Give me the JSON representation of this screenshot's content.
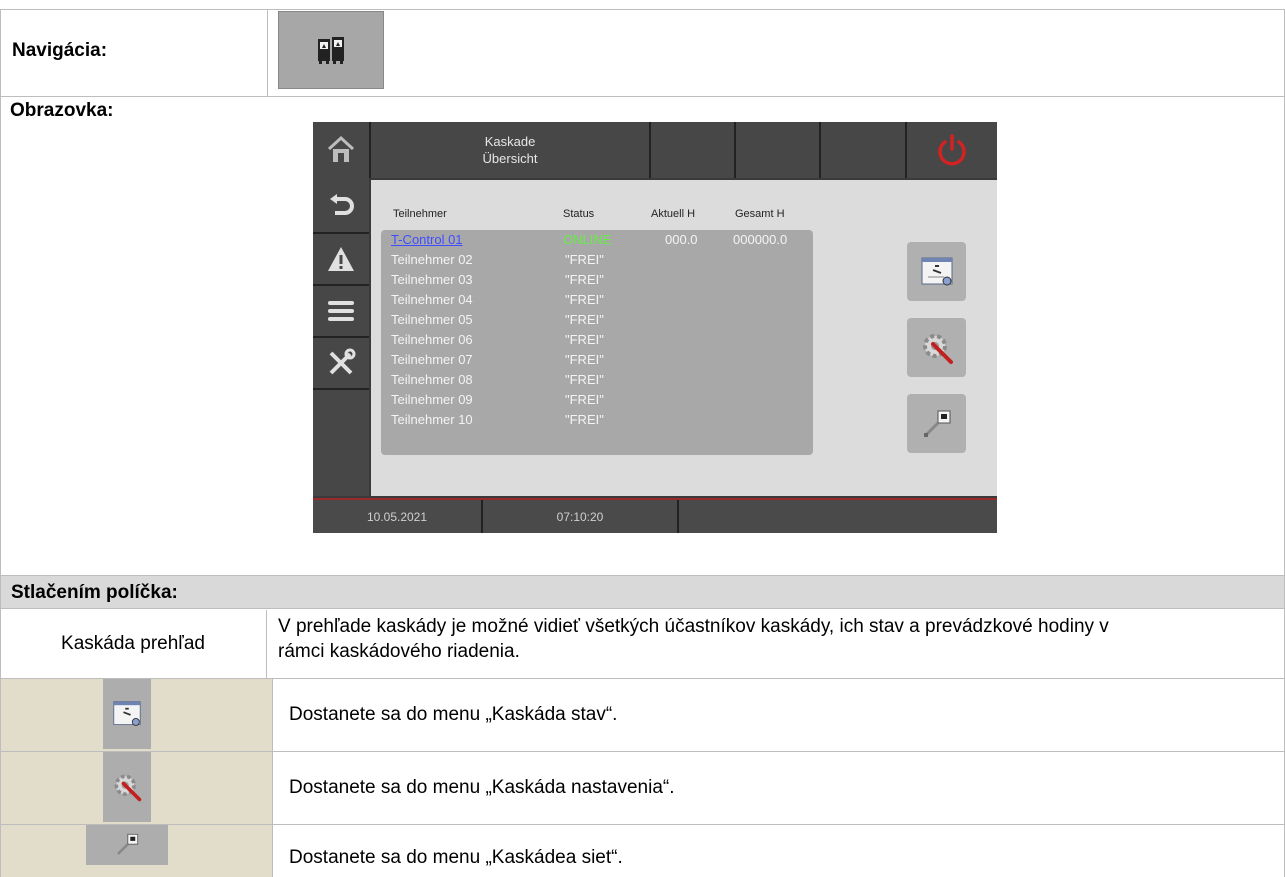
{
  "navigation": {
    "label": "Navigácia:",
    "icon": "cascade-boilers-icon"
  },
  "screen": {
    "label": "Obrazovka:",
    "device": {
      "title_line1": "Kaskade",
      "title_line2": "Übersicht",
      "columns": {
        "participant": "Teilnehmer",
        "status": "Status",
        "current": "Aktuell H",
        "total": "Gesamt H"
      },
      "rows": [
        {
          "name": "T-Control 01",
          "status": "ONLINE",
          "current": "000.0",
          "total": "000000.0"
        },
        {
          "name": "Teilnehmer 02",
          "status": "\"FREI\"",
          "current": "",
          "total": ""
        },
        {
          "name": "Teilnehmer 03",
          "status": "\"FREI\"",
          "current": "",
          "total": ""
        },
        {
          "name": "Teilnehmer 04",
          "status": "\"FREI\"",
          "current": "",
          "total": ""
        },
        {
          "name": "Teilnehmer 05",
          "status": "\"FREI\"",
          "current": "",
          "total": ""
        },
        {
          "name": "Teilnehmer 06",
          "status": "\"FREI\"",
          "current": "",
          "total": ""
        },
        {
          "name": "Teilnehmer 07",
          "status": "\"FREI\"",
          "current": "",
          "total": ""
        },
        {
          "name": "Teilnehmer 08",
          "status": "\"FREI\"",
          "current": "",
          "total": ""
        },
        {
          "name": "Teilnehmer 09",
          "status": "\"FREI\"",
          "current": "",
          "total": ""
        },
        {
          "name": "Teilnehmer 10",
          "status": "\"FREI\"",
          "current": "",
          "total": ""
        }
      ],
      "date": "10.05.2021",
      "time": "07:10:20",
      "colors": {
        "online": "#66ee44",
        "link": "#3f4dff",
        "power": "#d42222"
      }
    }
  },
  "press_section": {
    "label": "Stlačením políčka:",
    "overview_name": "Kaskáda prehľad",
    "overview_desc": "V prehľade kaskády je možné vidieť všetkých účastníkov kaskády, ich stav a prevádzkové hodiny v rámci kaskádového riadenia.",
    "items": [
      {
        "icon": "status-monitor-icon",
        "text": "Dostanete sa do menu „Kaskáda stav“."
      },
      {
        "icon": "settings-gear-icon",
        "text": "Dostanete sa do menu „Kaskáda nastavenia“."
      },
      {
        "icon": "network-plug-icon",
        "text": "Dostanete sa do menu „Kaskádea siet“."
      }
    ]
  }
}
